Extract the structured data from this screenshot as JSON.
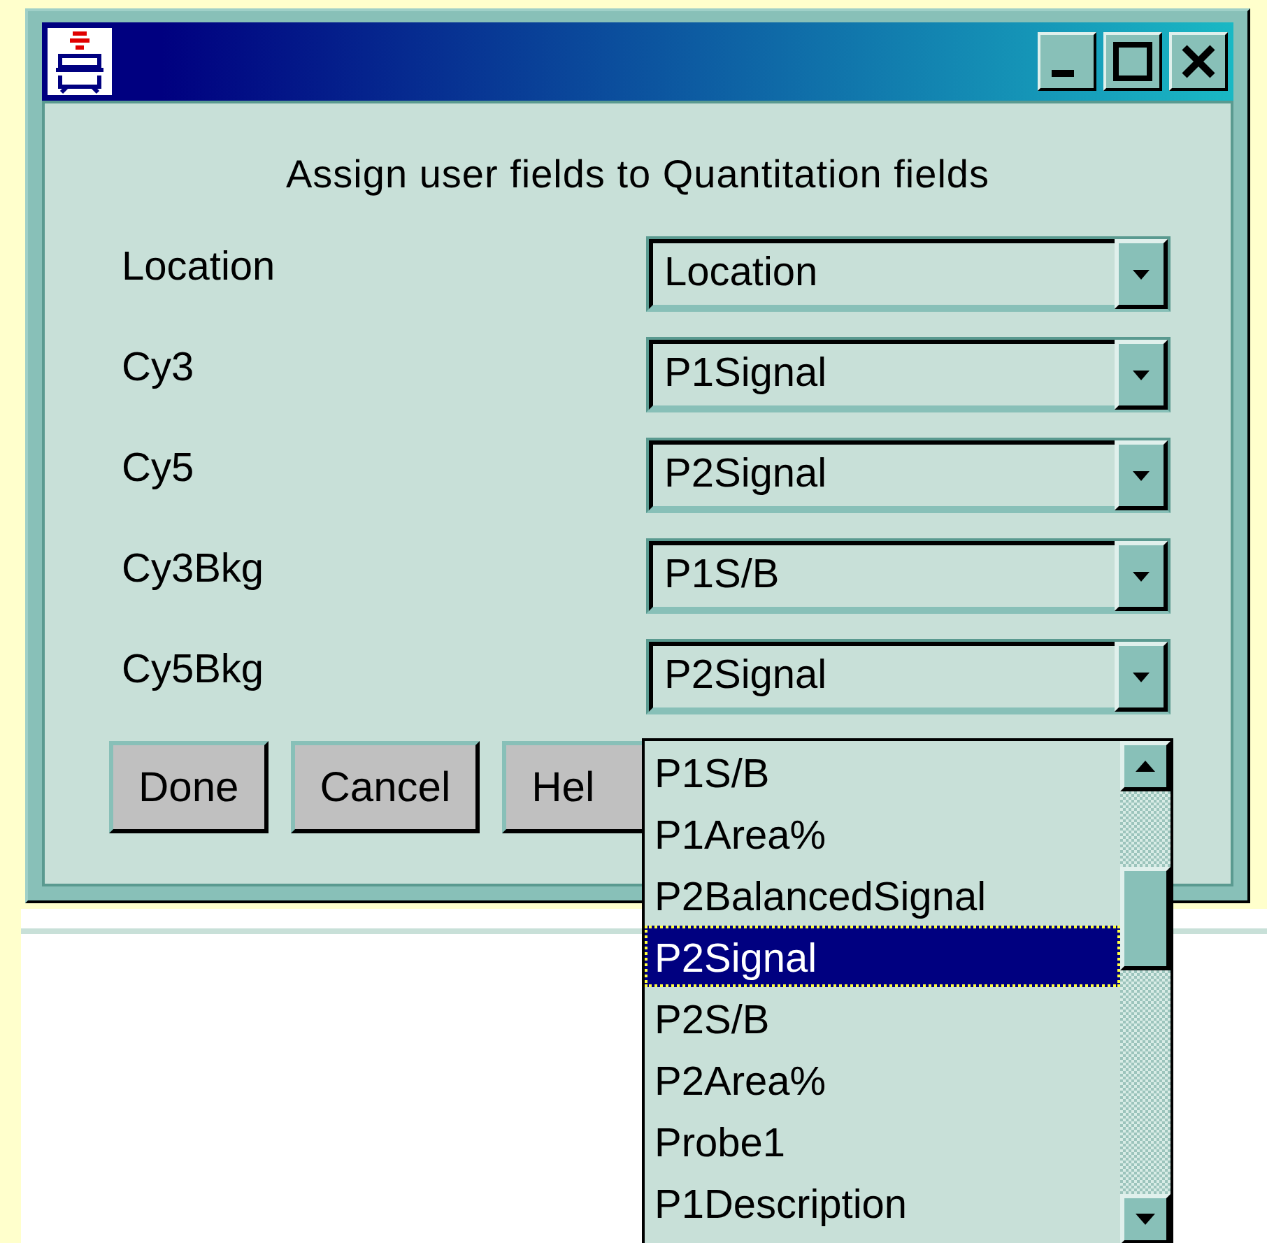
{
  "dialog": {
    "heading": "Assign user fields to Quantitation fields",
    "fields": [
      {
        "label": "Location",
        "value": "Location"
      },
      {
        "label": "Cy3",
        "value": "P1Signal"
      },
      {
        "label": "Cy5",
        "value": "P2Signal"
      },
      {
        "label": "Cy3Bkg",
        "value": "P1S/B"
      },
      {
        "label": "Cy5Bkg",
        "value": "P2Signal"
      }
    ],
    "buttons": [
      "Done",
      "Cancel",
      "Hel"
    ]
  },
  "dropdown_list": {
    "items": [
      {
        "label": "P1S/B",
        "selected": false
      },
      {
        "label": "P1Area%",
        "selected": false
      },
      {
        "label": "P2BalancedSignal",
        "selected": false
      },
      {
        "label": "P2Signal",
        "selected": true
      },
      {
        "label": "P2S/B",
        "selected": false
      },
      {
        "label": "P2Area%",
        "selected": false
      },
      {
        "label": "Probe1",
        "selected": false
      },
      {
        "label": "P1Description",
        "selected": false
      }
    ]
  }
}
